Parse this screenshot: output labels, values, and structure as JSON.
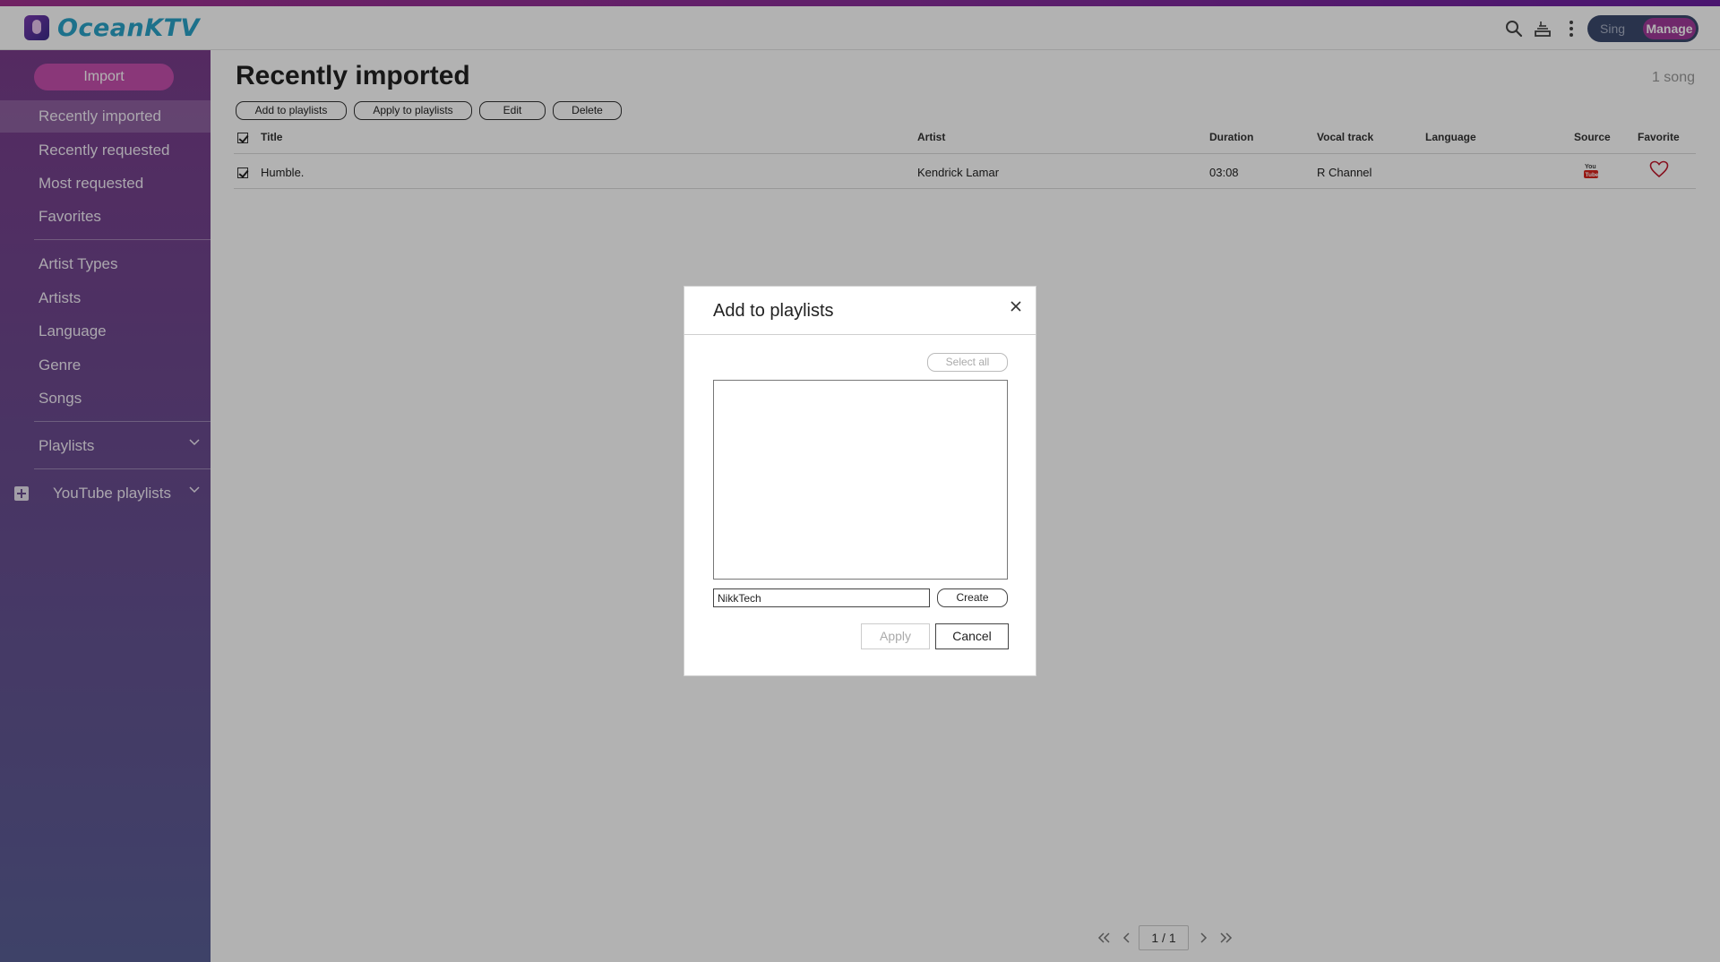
{
  "app": {
    "brand": "OceanKTV",
    "mode_sing": "Sing",
    "mode_manage": "Manage",
    "accent_color": "#a13a9a",
    "icons": [
      "search-icon",
      "queue-icon",
      "more-vert-icon"
    ]
  },
  "sidebar": {
    "import_label": "Import",
    "items": [
      {
        "label": "Recently imported",
        "active": true
      },
      {
        "label": "Recently requested"
      },
      {
        "label": "Most requested"
      },
      {
        "label": "Favorites"
      },
      {
        "label": "Artist Types"
      },
      {
        "label": "Artists"
      },
      {
        "label": "Language"
      },
      {
        "label": "Genre"
      },
      {
        "label": "Songs"
      }
    ],
    "playlists": "Playlists",
    "youtube_playlists": "YouTube playlists"
  },
  "main": {
    "title": "Recently imported",
    "count": "1 song",
    "toolbar": {
      "add_to_playlists": "Add to playlists",
      "apply_to_playlists": "Apply to playlists",
      "edit": "Edit",
      "delete": "Delete"
    },
    "columns": {
      "title": "Title",
      "artist": "Artist",
      "duration": "Duration",
      "vocal_track": "Vocal track",
      "language": "Language",
      "source": "Source",
      "favorite": "Favorite"
    },
    "rows": [
      {
        "title": "Humble.",
        "artist": "Kendrick Lamar",
        "duration": "03:08",
        "vocal_track": "R Channel",
        "language": "",
        "source": "youtube-icon",
        "favorite": "heart-icon"
      }
    ],
    "pager": {
      "page": "1 / 1"
    }
  },
  "dialog": {
    "title": "Add to playlists",
    "select_all": "Select all",
    "new_playlist_value": "NikkTech",
    "create": "Create",
    "apply": "Apply",
    "cancel": "Cancel"
  }
}
